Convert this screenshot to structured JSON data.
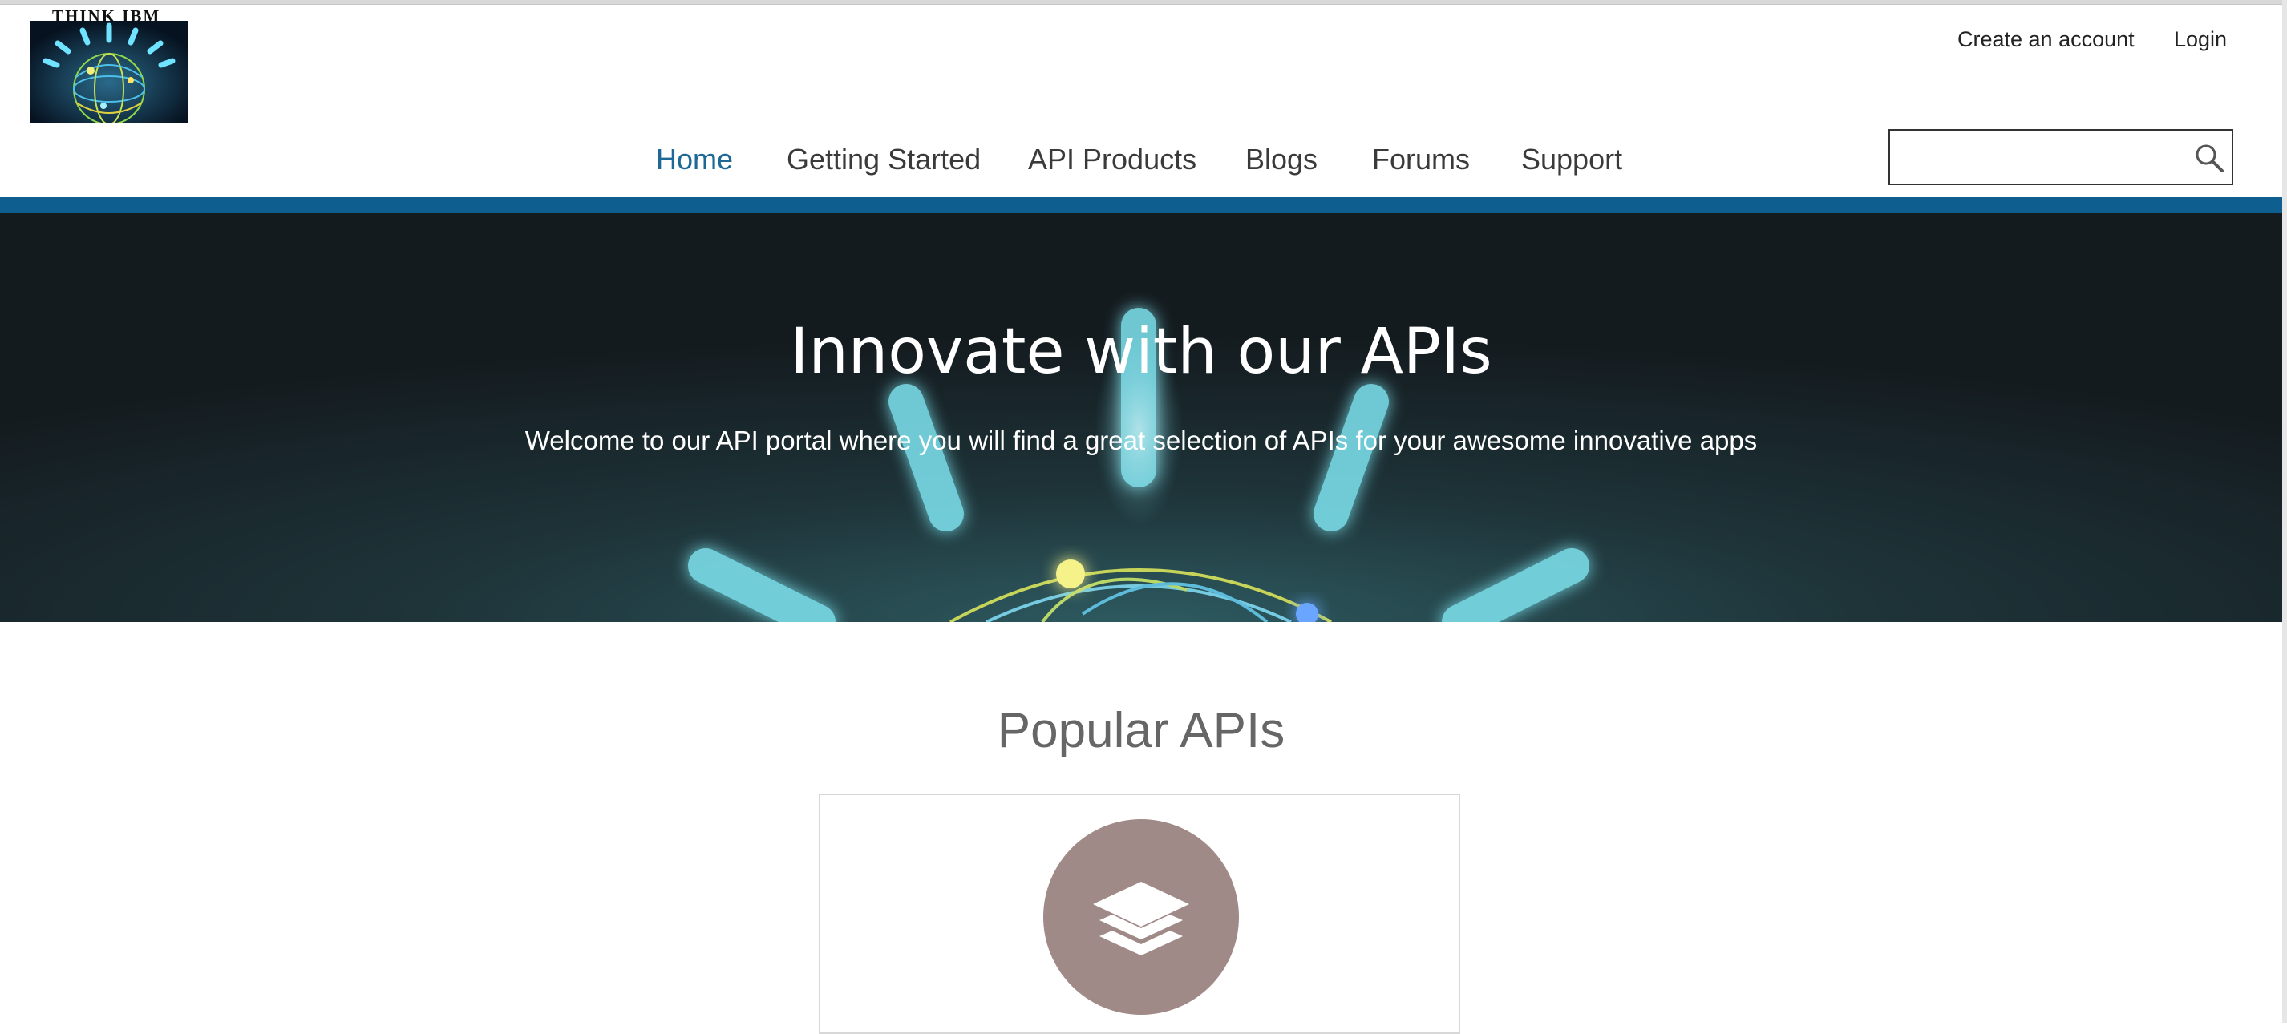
{
  "logo": {
    "text": "THINK IBM"
  },
  "header": {
    "create_account": "Create an account",
    "login": "Login"
  },
  "nav": {
    "items": [
      {
        "label": "Home",
        "active": true
      },
      {
        "label": "Getting Started"
      },
      {
        "label": "API Products"
      },
      {
        "label": "Blogs"
      },
      {
        "label": "Forums"
      },
      {
        "label": "Support"
      }
    ]
  },
  "search": {
    "value": "",
    "placeholder": "",
    "icon": "search-icon"
  },
  "hero": {
    "title": "Innovate with our APIs",
    "subtitle": "Welcome to our API portal where you will find a great selection of APIs for your awesome innovative apps"
  },
  "popular": {
    "title": "Popular APIs",
    "card_icon": "layers-icon"
  },
  "colors": {
    "accent": "#0e5e8f",
    "nav_active": "#1d6896",
    "card_icon_bg": "#a08a87"
  }
}
